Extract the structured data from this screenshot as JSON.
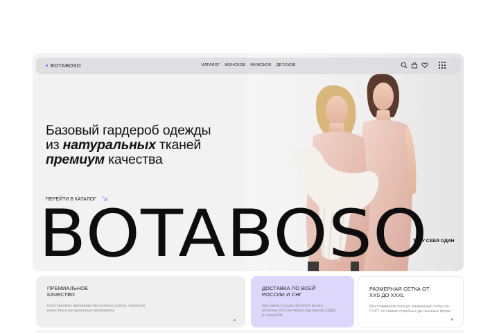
{
  "brand": {
    "logo": "BOTABOSO",
    "big_wordmark": "BOTABOSO",
    "accent": "#7c6cf0"
  },
  "nav": {
    "items": [
      {
        "label": "КАТАЛОГ"
      },
      {
        "label": "ЖЕНСКОЕ"
      },
      {
        "label": "МУЖСКОЕ"
      },
      {
        "label": "ДЕТСКОЕ"
      }
    ],
    "icons": [
      "search-icon",
      "bag-icon",
      "heart-icon",
      "grid-menu-icon"
    ]
  },
  "hero": {
    "headline_line1": "Базовый гардероб одежды",
    "headline_line2_prefix": "из ",
    "headline_line2_emphasis": "натуральных",
    "headline_line2_suffix": " тканей",
    "headline_line3_emphasis": "премиум",
    "headline_line3_suffix": " качества",
    "cta_label": "ПЕРЕЙТИ В КАТАЛОГ",
    "slogan": "ТЫ У  СЕБЯ ОДИН"
  },
  "cards": [
    {
      "title": "ПРЕМИАЛЬНОЕ КАЧЕСТВО",
      "text": "Собственное производство полного цикла, гарантия качества и натуральные материалы",
      "background": "#efefef"
    },
    {
      "title": "ДОСТАВКА ПО ВСЕЙ РОССИИ И СНГ",
      "text": "Доставка осуществляется во все регионы России через партнеров СДЕК и почта РФ",
      "background": "#dcd7fb"
    },
    {
      "title": "РАЗМЕРНАЯ СЕТКА ОТ XXS ДО XXXL",
      "text": "Мы отшиваем полную размерную сетку по ГОСТ от самых стройных до пышных форм",
      "background": "#ffffff"
    }
  ]
}
